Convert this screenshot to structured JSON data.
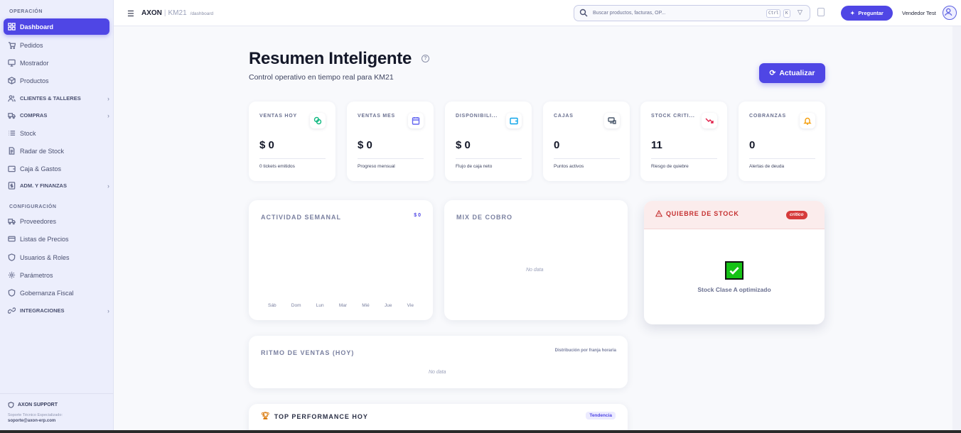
{
  "sidebar": {
    "section_operacion": "OPERACIÓN",
    "section_config": "CONFIGURACIÓN",
    "items": [
      {
        "label": "Dashboard"
      },
      {
        "label": "Pedidos"
      },
      {
        "label": "Mostrador"
      },
      {
        "label": "Productos"
      },
      {
        "label": "CLIENTES & TALLERES"
      },
      {
        "label": "COMPRAS"
      },
      {
        "label": "Stock"
      },
      {
        "label": "Radar de Stock"
      },
      {
        "label": "Caja & Gastos"
      },
      {
        "label": "ADM. Y FINANZAS"
      }
    ],
    "config_items": [
      {
        "label": "Proveedores"
      },
      {
        "label": "Listas de Precios"
      },
      {
        "label": "Usuarios & Roles"
      },
      {
        "label": "Parámetros"
      },
      {
        "label": "Gobernanza Fiscal"
      },
      {
        "label": "INTEGRACIONES"
      }
    ],
    "support": {
      "title": "AXON SUPPORT",
      "subtitle": "Soporte Técnico Especializado:",
      "email": "soporte@axon-erp.com"
    }
  },
  "topbar": {
    "brand": "AXON",
    "company": "KM21",
    "path": "/dashboard",
    "search_placeholder": "Buscar productos, facturas, OP...",
    "kbd_ctrl": "Ctrl",
    "kbd_k": "K",
    "ask_label": "Preguntar",
    "user_name": "Vendedor Test"
  },
  "page": {
    "title": "Resumen Inteligente",
    "subtitle": "Control operativo en tiempo real para KM21",
    "refresh_label": "Actualizar"
  },
  "kpis": [
    {
      "label": "VENTAS HOY",
      "value": "$ 0",
      "foot": "0 tickets emitidos",
      "icon": "coins-icon",
      "color": "#10b981"
    },
    {
      "label": "VENTAS MES",
      "value": "$ 0",
      "foot": "Progreso mensual",
      "icon": "calendar-icon",
      "color": "#6366f1"
    },
    {
      "label": "DISPONIBILI...",
      "value": "$ 0",
      "foot": "Flujo de caja neto",
      "icon": "wallet-icon",
      "color": "#0ea5e9"
    },
    {
      "label": "CAJAS",
      "value": "0",
      "foot": "Puntos activos",
      "icon": "register-icon",
      "color": "#475569"
    },
    {
      "label": "STOCK CRÍTI...",
      "value": "11",
      "foot": "Riesgo de quiebre",
      "icon": "trending-down-icon",
      "color": "#e11d48"
    },
    {
      "label": "COBRANZAS",
      "value": "0",
      "foot": "Alertas de deuda",
      "icon": "bell-icon",
      "color": "#f59e0b"
    }
  ],
  "activity": {
    "title": "ACTIVIDAD SEMANAL",
    "total": "$ 0",
    "days": [
      "Sáb",
      "Dom",
      "Lun",
      "Mar",
      "Mié",
      "Jue",
      "Vie"
    ]
  },
  "mix": {
    "title": "MIX DE COBRO",
    "empty": "No data"
  },
  "quiebre": {
    "title": "QUIEBRE DE STOCK",
    "badge": "crítico",
    "message": "Stock Clase A optimizado"
  },
  "ritmo": {
    "title": "RITMO DE VENTAS (HOY)",
    "note": "Distribución por franja horaria",
    "empty": "No data"
  },
  "top": {
    "title": "TOP PERFORMANCE HOY",
    "badge": "Tendencia"
  }
}
